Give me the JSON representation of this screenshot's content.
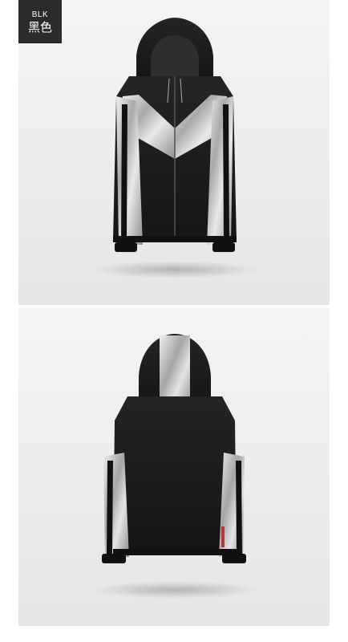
{
  "color_badge": {
    "code": "BLK",
    "name_cn": "黑色"
  },
  "product_views": [
    {
      "view": "front"
    },
    {
      "view": "back"
    }
  ],
  "colors": {
    "jacket_body": "#1a1a1a",
    "silver_panel": "#c9c9c9",
    "badge_bg": "#2b2b2b",
    "background": "#efefef"
  }
}
